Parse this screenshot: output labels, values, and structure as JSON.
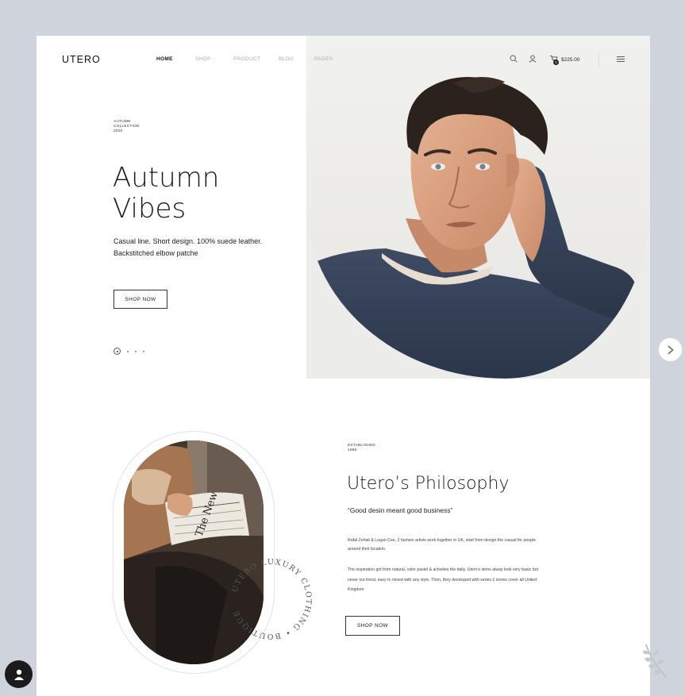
{
  "brand": {
    "logo": "UTERO"
  },
  "nav": {
    "items": [
      {
        "label": "HOME",
        "active": true
      },
      {
        "label": "SHOP",
        "active": false
      },
      {
        "label": "PRODUCT",
        "active": false
      },
      {
        "label": "BLOG",
        "active": false
      },
      {
        "label": "PAGES",
        "active": false
      }
    ]
  },
  "header": {
    "cart_count": "0",
    "cart_total": "$225.00",
    "icons": [
      "search-icon",
      "user-icon",
      "cart-icon",
      "menu-icon"
    ]
  },
  "hero": {
    "collection_line1": "AUTUMN",
    "collection_line2": "COLLECTION",
    "collection_line3": "2020",
    "title_line1": "Autumn",
    "title_line2": "Vibes",
    "desc_line1": "Casual line. Short design. 100% suede leather.",
    "desc_line2": "Backstitched elbow patche",
    "button": "SHOP NOW",
    "slides_total": 4,
    "slide_active": 1
  },
  "philosophy": {
    "established_line1": "ESTABLISHED",
    "established_line2": "1966",
    "title": "Utero’s Philosophy",
    "quote": "“Good desin meant good business”",
    "paragraph1": "Rafal Zerlak & Logan Cee, 2 fashion artists work together in UK, start from design the casual for people around their location.",
    "paragraph2": "The inspiration got from natural, color pastel & activities the daily. Utero's items alway look very basic but never out trend, easy to mixed with any style. Then, they developed with series 2 stores cover all United Kingdom",
    "button": "SHOP NOW",
    "stamp_text": "UTERO LUXURY CLOTHING • BOUTIQUE"
  },
  "colors": {
    "background": "#cfd3dc",
    "card": "#ffffff",
    "hero_bg": "#ececea",
    "sweater": "#35425a",
    "text": "#1a1a1a"
  }
}
